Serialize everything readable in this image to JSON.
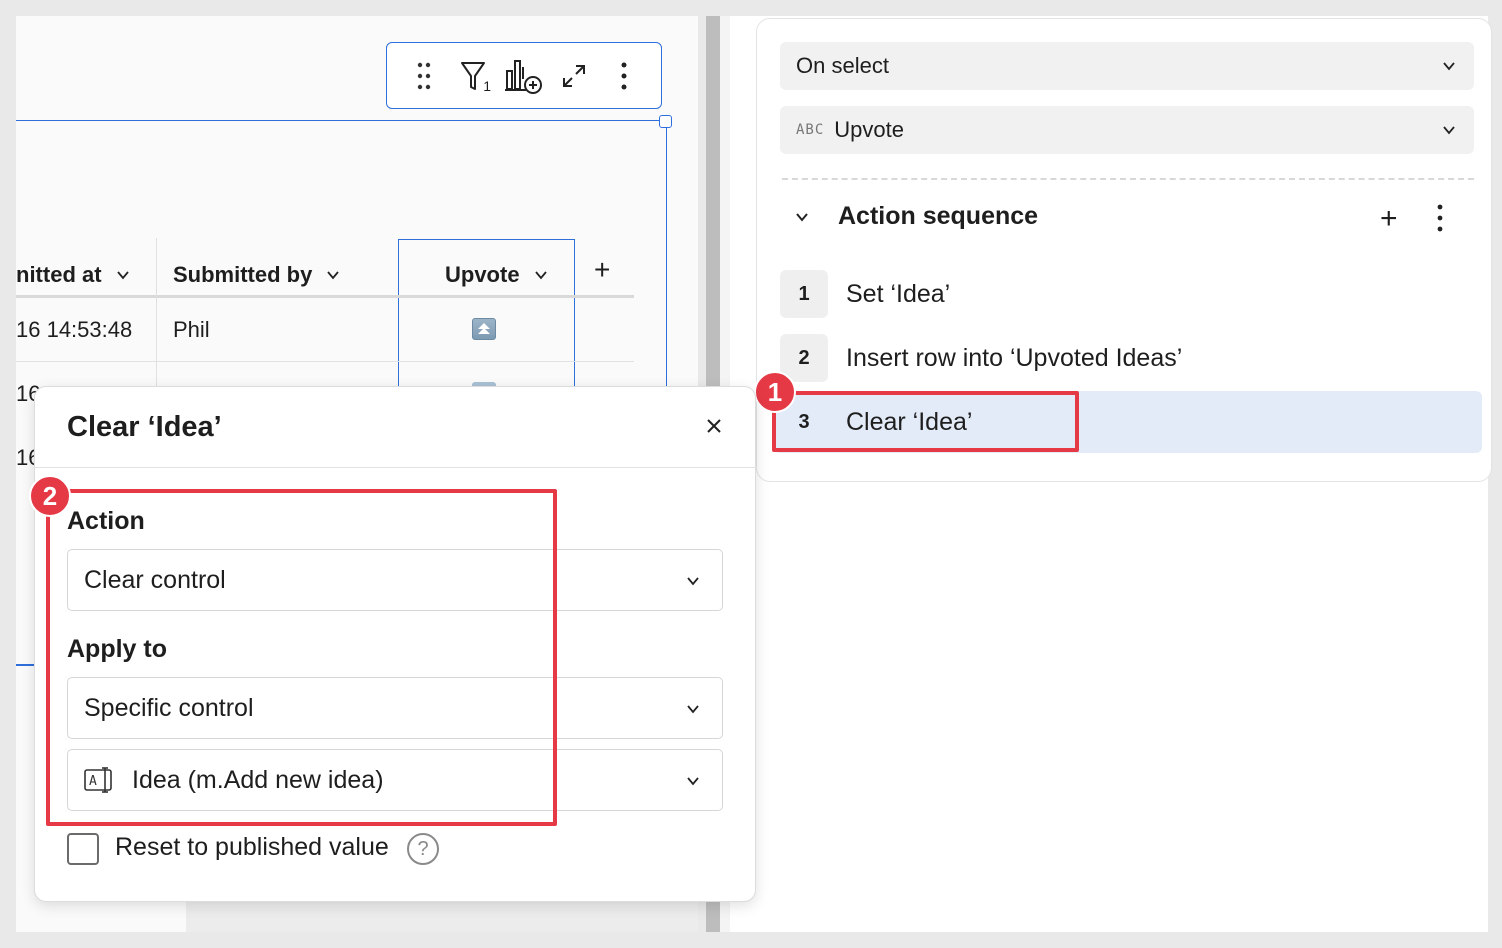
{
  "toolbar": {
    "drag_icon": "drag-handle-icon",
    "filter_icon": "filter-icon",
    "filter_count": "1",
    "add_chart_icon": "add-chart-icon",
    "expand_icon": "expand-icon",
    "more_icon": "more-vertical-icon"
  },
  "table": {
    "columns": [
      {
        "label": "nitted at"
      },
      {
        "label": "Submitted by"
      },
      {
        "label": "Upvote"
      }
    ],
    "add_column_label": "+",
    "rows": [
      {
        "submitted_at": "16 14:53:48",
        "submitted_by": "Phil"
      },
      {
        "submitted_at": "16",
        "submitted_by": ""
      },
      {
        "submitted_at": "16",
        "submitted_by": ""
      }
    ]
  },
  "action_panel": {
    "trigger": "On select",
    "column_type": "ABC",
    "column": "Upvote",
    "sequence_title": "Action sequence",
    "add_label": "+",
    "steps": [
      {
        "num": "1",
        "label": "Set ‘Idea’"
      },
      {
        "num": "2",
        "label": "Insert row into ‘Upvoted Ideas’"
      },
      {
        "num": "3",
        "label": "Clear ‘Idea’"
      }
    ]
  },
  "popover": {
    "title": "Clear ‘Idea’",
    "action_label": "Action",
    "action_value": "Clear control",
    "apply_to_label": "Apply to",
    "apply_to_value": "Specific control",
    "control_value": "Idea (m.Add new idea)",
    "reset_label": "Reset to published value",
    "reset_checked": false,
    "help": "?"
  },
  "annotations": {
    "badge1": "1",
    "badge2": "2",
    "color": "#e63946"
  },
  "colors": {
    "accent_blue": "#2f6fdb",
    "selected_step_bg": "#e3ebf8"
  }
}
